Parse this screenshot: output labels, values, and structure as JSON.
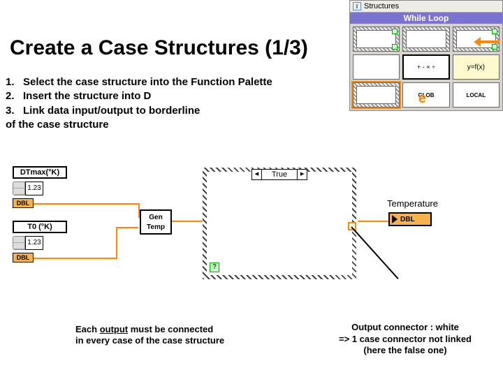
{
  "palette": {
    "title": "Structures",
    "banner": "While Loop",
    "items": {
      "formula": "+ - × ÷",
      "yfx": "y=f(x)",
      "glob": "GLOB",
      "local": "LOCAL"
    },
    "selected_marker": "e"
  },
  "title": "Create a Case Structures (1/3)",
  "instructions": {
    "i1": "1.   Select the case structure into the Function Palette",
    "i2": "2.   Insert the structure into D",
    "i3": "3.   Link data input/output to borderline",
    "tail": "of the case structure"
  },
  "controls": {
    "dtmax_label": "DTmax(°K)",
    "t0_label": "T0 (°K)",
    "spin_val": "1.23",
    "dbl": "DBL"
  },
  "gen_temp": "Gen Temp",
  "case": {
    "left_arrow": "◂",
    "value": "True",
    "right_arrow": "▸",
    "q": "?"
  },
  "indicator": {
    "label": "Temperature",
    "dbl": "DBL"
  },
  "captions": {
    "left_1a": "Each ",
    "left_1b": "output",
    "left_1c": " must be connected",
    "left_2": "in every case of the case structure",
    "right_1": "Output connector : white",
    "right_2": "=> 1 case connector not linked",
    "right_3": "(here the false one)"
  }
}
